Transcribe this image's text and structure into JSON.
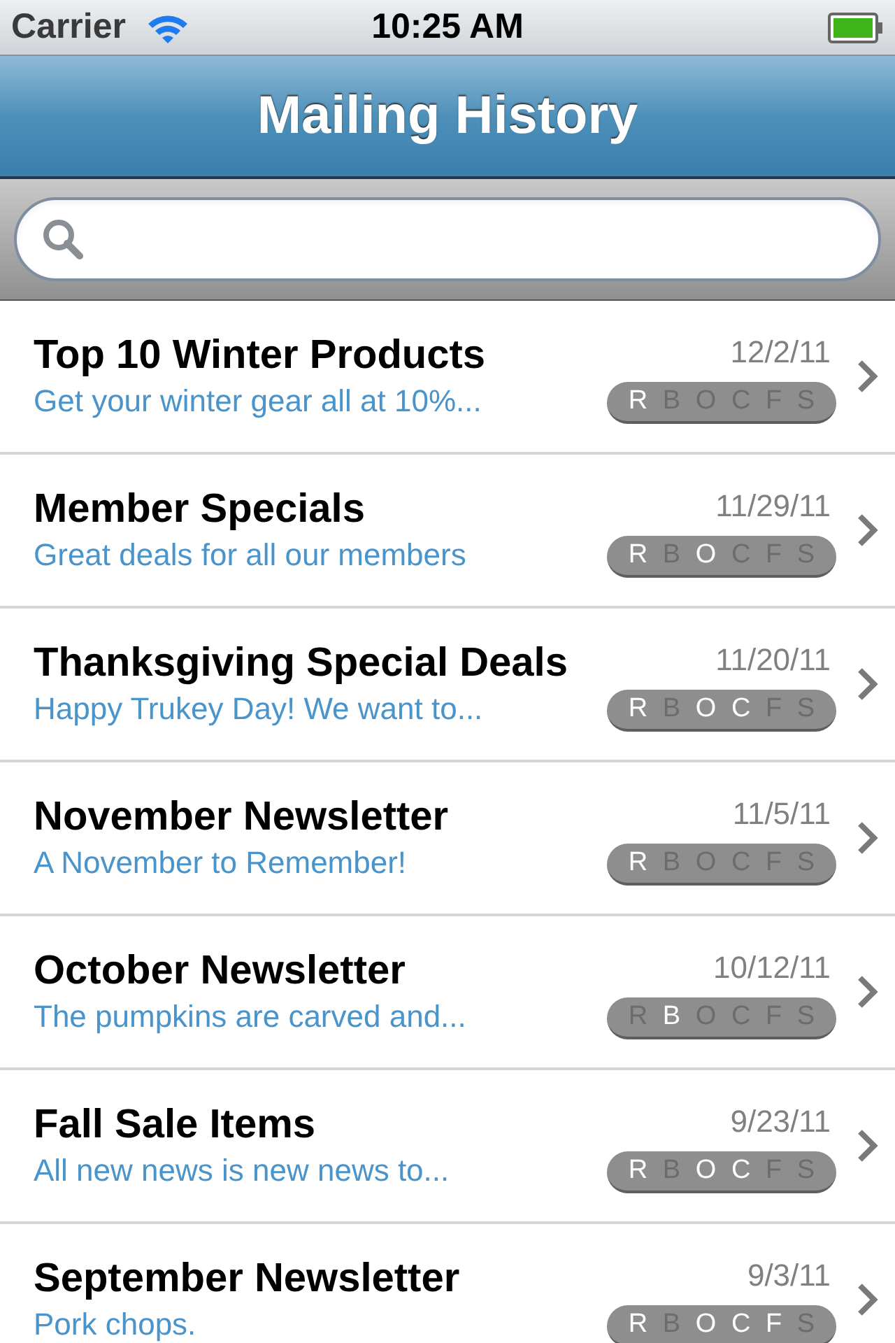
{
  "status_bar": {
    "carrier": "Carrier",
    "time": "10:25 AM"
  },
  "nav_bar": {
    "title": "Mailing History"
  },
  "mailings": [
    {
      "title": "Top 10 Winter Products",
      "subtitle": "Get your winter gear all at 10%...",
      "date": "12/2/11",
      "flags": [
        {
          "letter": "R",
          "on": true
        },
        {
          "letter": "B",
          "on": false
        },
        {
          "letter": "O",
          "on": false
        },
        {
          "letter": "C",
          "on": false
        },
        {
          "letter": "F",
          "on": false
        },
        {
          "letter": "S",
          "on": false
        }
      ]
    },
    {
      "title": "Member Specials",
      "subtitle": "Great deals for all our members",
      "date": "11/29/11",
      "flags": [
        {
          "letter": "R",
          "on": true
        },
        {
          "letter": "B",
          "on": false
        },
        {
          "letter": "O",
          "on": true
        },
        {
          "letter": "C",
          "on": false
        },
        {
          "letter": "F",
          "on": false
        },
        {
          "letter": "S",
          "on": false
        }
      ]
    },
    {
      "title": "Thanksgiving Special Deals",
      "subtitle": "Happy Trukey Day! We want to...",
      "date": "11/20/11",
      "flags": [
        {
          "letter": "R",
          "on": true
        },
        {
          "letter": "B",
          "on": false
        },
        {
          "letter": "O",
          "on": true
        },
        {
          "letter": "C",
          "on": true
        },
        {
          "letter": "F",
          "on": false
        },
        {
          "letter": "S",
          "on": false
        }
      ]
    },
    {
      "title": "November Newsletter",
      "subtitle": "A November to Remember!",
      "date": "11/5/11",
      "flags": [
        {
          "letter": "R",
          "on": true
        },
        {
          "letter": "B",
          "on": false
        },
        {
          "letter": "O",
          "on": false
        },
        {
          "letter": "C",
          "on": false
        },
        {
          "letter": "F",
          "on": false
        },
        {
          "letter": "S",
          "on": false
        }
      ]
    },
    {
      "title": "October Newsletter",
      "subtitle": "The pumpkins are carved and...",
      "date": "10/12/11",
      "flags": [
        {
          "letter": "R",
          "on": false
        },
        {
          "letter": "B",
          "on": true
        },
        {
          "letter": "O",
          "on": false
        },
        {
          "letter": "C",
          "on": false
        },
        {
          "letter": "F",
          "on": false
        },
        {
          "letter": "S",
          "on": false
        }
      ]
    },
    {
      "title": "Fall Sale Items",
      "subtitle": "All new news is new news to...",
      "date": "9/23/11",
      "flags": [
        {
          "letter": "R",
          "on": true
        },
        {
          "letter": "B",
          "on": false
        },
        {
          "letter": "O",
          "on": true
        },
        {
          "letter": "C",
          "on": true
        },
        {
          "letter": "F",
          "on": false
        },
        {
          "letter": "S",
          "on": false
        }
      ]
    },
    {
      "title": "September Newsletter",
      "subtitle": "Pork chops.",
      "date": "9/3/11",
      "flags": [
        {
          "letter": "R",
          "on": true
        },
        {
          "letter": "B",
          "on": false
        },
        {
          "letter": "O",
          "on": true
        },
        {
          "letter": "C",
          "on": true
        },
        {
          "letter": "F",
          "on": true
        },
        {
          "letter": "S",
          "on": false
        }
      ]
    }
  ]
}
